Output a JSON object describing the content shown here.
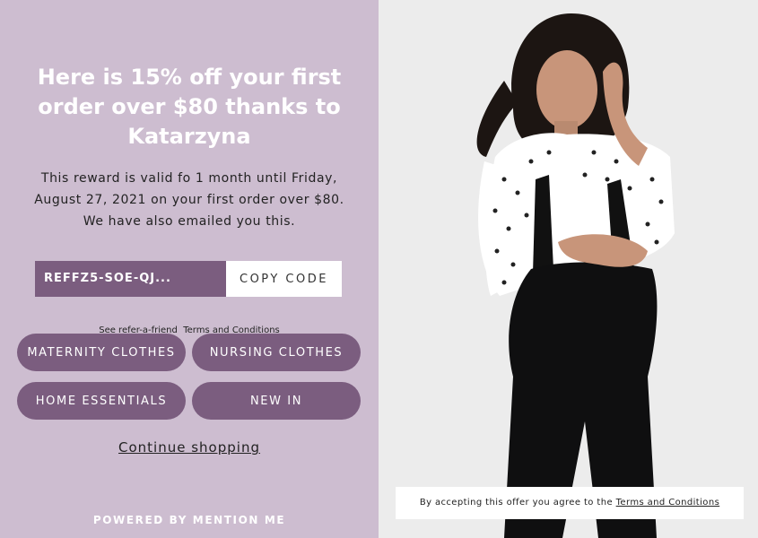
{
  "offer": {
    "headline": "Here is 15% off your first order over $80 thanks to Katarzyna",
    "description": "This reward is valid fo 1 month until Friday, August 27, 2021 on your first order over $80. We have also emailed you this.",
    "code": "REFFZ5-SOE-QJ...",
    "copy_label": "COPY CODE",
    "refer_text": "See refer-a-friend",
    "refer_link": "Terms and Conditions"
  },
  "categories": [
    "MATERNITY CLOTHES",
    "NURSING CLOTHES",
    "HOME ESSENTIALS",
    "NEW IN"
  ],
  "continue_label": "Continue shopping",
  "powered_by": "POWERED BY MENTION ME",
  "consent": {
    "text": "By accepting this offer you agree to the",
    "link": "Terms and Conditions"
  },
  "colors": {
    "panel": "#cdbdd0",
    "accent": "#7b5d7f"
  }
}
